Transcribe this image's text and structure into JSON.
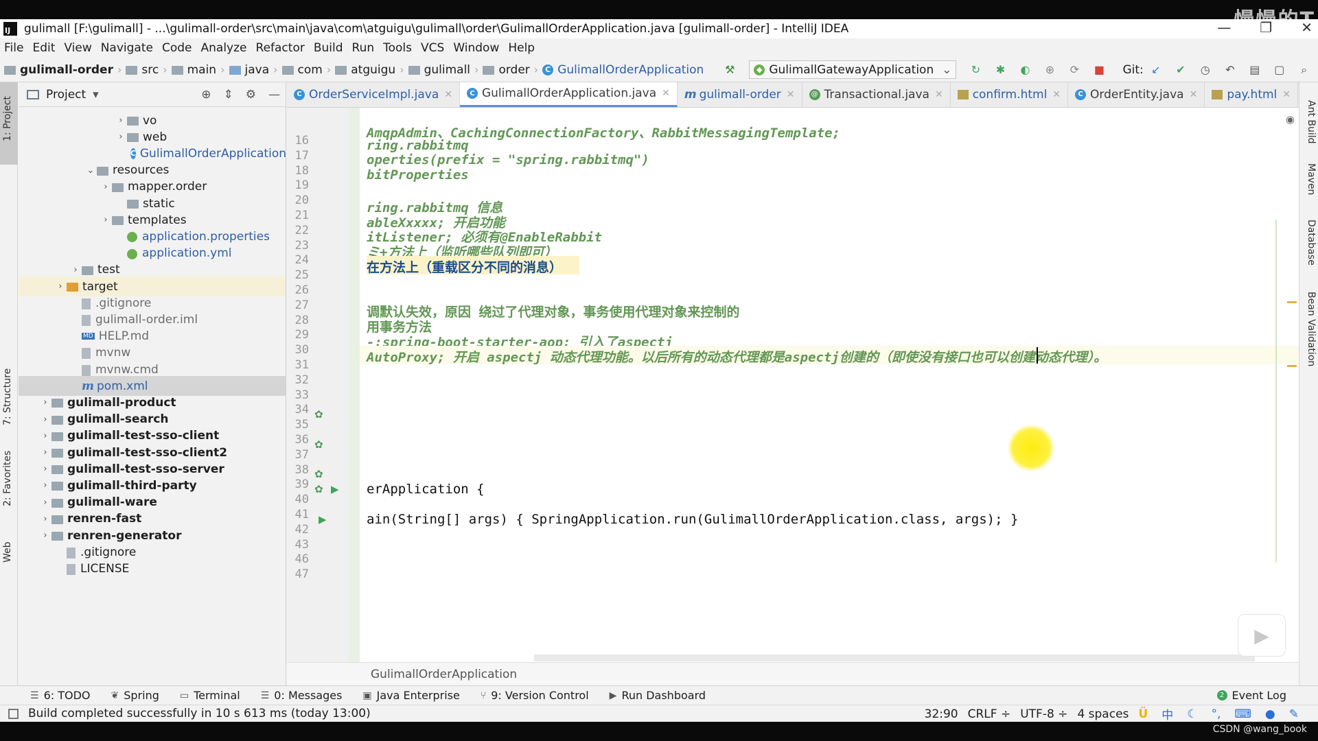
{
  "window": {
    "title": "gulimall [F:\\gulimall] - ...\\gulimall-order\\src\\main\\java\\com\\atguigu\\gulimall\\order\\GulimallOrderApplication.java [gulimall-order] - IntelliJ IDEA",
    "logo": "IJ",
    "minimize": "—",
    "maximize": "❐",
    "close": "✕"
  },
  "overlay": {
    "watermark_top": "慢慢的T",
    "watermark_bottom": "CSDN @wang_book"
  },
  "menu": [
    "File",
    "Edit",
    "View",
    "Navigate",
    "Code",
    "Analyze",
    "Refactor",
    "Build",
    "Run",
    "Tools",
    "VCS",
    "Window",
    "Help"
  ],
  "navbar": {
    "project": "gulimall-order",
    "crumbs": [
      "src",
      "main",
      "java",
      "com",
      "atguigu",
      "gulimall",
      "order"
    ],
    "class": "GulimallOrderApplication",
    "run_config": "GulimallGatewayApplication",
    "git_label": "Git:"
  },
  "sidebar_left": {
    "project": "1: Project",
    "structure": "7: Structure",
    "favorites": "2: Favorites",
    "web": "Web"
  },
  "sidebar_right": {
    "ant": "Ant Build",
    "maven": "Maven",
    "database": "Database",
    "bean": "Bean Validation"
  },
  "project_panel": {
    "title": "Project",
    "items": [
      {
        "label": "vo",
        "depth": 6,
        "arrow": "›",
        "icon": "folder"
      },
      {
        "label": "web",
        "depth": 6,
        "arrow": "›",
        "icon": "folder"
      },
      {
        "label": "GulimallOrderApplication",
        "depth": 7,
        "arrow": "",
        "icon": "class"
      },
      {
        "label": "resources",
        "depth": 4,
        "arrow": "⌄",
        "icon": "folder"
      },
      {
        "label": "mapper.order",
        "depth": 5,
        "arrow": "›",
        "icon": "folder"
      },
      {
        "label": "static",
        "depth": 6,
        "arrow": "",
        "icon": "folder"
      },
      {
        "label": "templates",
        "depth": 5,
        "arrow": "›",
        "icon": "folder"
      },
      {
        "label": "application.properties",
        "depth": 6,
        "arrow": "",
        "icon": "green"
      },
      {
        "label": "application.yml",
        "depth": 6,
        "arrow": "",
        "icon": "green"
      },
      {
        "label": "test",
        "depth": 3,
        "arrow": "›",
        "icon": "folder"
      },
      {
        "label": "target",
        "depth": 2,
        "arrow": "›",
        "icon": "folder-orange"
      },
      {
        "label": ".gitignore",
        "depth": 3,
        "arrow": "",
        "icon": "file"
      },
      {
        "label": "gulimall-order.iml",
        "depth": 3,
        "arrow": "",
        "icon": "file"
      },
      {
        "label": "HELP.md",
        "depth": 3,
        "arrow": "",
        "icon": "md"
      },
      {
        "label": "mvnw",
        "depth": 3,
        "arrow": "",
        "icon": "file"
      },
      {
        "label": "mvnw.cmd",
        "depth": 3,
        "arrow": "",
        "icon": "file"
      },
      {
        "label": "pom.xml",
        "depth": 3,
        "arrow": "",
        "icon": "maven"
      },
      {
        "label": "gulimall-product",
        "depth": 1,
        "arrow": "›",
        "icon": "folder"
      },
      {
        "label": "gulimall-search",
        "depth": 1,
        "arrow": "›",
        "icon": "folder"
      },
      {
        "label": "gulimall-test-sso-client",
        "depth": 1,
        "arrow": "›",
        "icon": "folder"
      },
      {
        "label": "gulimall-test-sso-client2",
        "depth": 1,
        "arrow": "›",
        "icon": "folder"
      },
      {
        "label": "gulimall-test-sso-server",
        "depth": 1,
        "arrow": "›",
        "icon": "folder"
      },
      {
        "label": "gulimall-third-party",
        "depth": 1,
        "arrow": "›",
        "icon": "folder"
      },
      {
        "label": "gulimall-ware",
        "depth": 1,
        "arrow": "›",
        "icon": "folder"
      },
      {
        "label": "renren-fast",
        "depth": 1,
        "arrow": "›",
        "icon": "folder"
      },
      {
        "label": "renren-generator",
        "depth": 1,
        "arrow": "›",
        "icon": "folder"
      },
      {
        "label": ".gitignore",
        "depth": 2,
        "arrow": "",
        "icon": "file"
      },
      {
        "label": "LICENSE",
        "depth": 2,
        "arrow": "",
        "icon": "file"
      }
    ]
  },
  "tabs": [
    {
      "label": "OrderServiceImpl.java",
      "icon": "C"
    },
    {
      "label": "GulimallOrderApplication.java",
      "icon": "C"
    },
    {
      "label": "gulimall-order",
      "icon": "m"
    },
    {
      "label": "Transactional.java",
      "icon": "@"
    },
    {
      "label": "confirm.html",
      "icon": "H"
    },
    {
      "label": "OrderEntity.java",
      "icon": "C"
    },
    {
      "label": "pay.html",
      "icon": "H"
    }
  ],
  "editor": {
    "lines": [
      {
        "n": "16",
        "text": ""
      },
      {
        "n": "17",
        "text": "AmqpAdmin、CachingConnectionFactory、RabbitMessagingTemplate;"
      },
      {
        "n": "18",
        "text": "ring.rabbitmq"
      },
      {
        "n": "19",
        "text": "operties(prefix = \"spring.rabbitmq\")"
      },
      {
        "n": "20",
        "text": "bitProperties"
      },
      {
        "n": "21",
        "text": ""
      },
      {
        "n": "22",
        "text": "ring.rabbitmq 信息"
      },
      {
        "n": "23",
        "text": "ableXxxxx; 开启功能"
      },
      {
        "n": "24",
        "text": "itListener; 必须有@EnableRabbit"
      },
      {
        "n": "25",
        "text": "ミ+方法上（监听哪些队列即可）"
      },
      {
        "n": "26",
        "text": "在方法上（重载区分不同的消息）"
      },
      {
        "n": "27",
        "text": ""
      },
      {
        "n": "28",
        "text": ""
      },
      {
        "n": "29",
        "text": "调默认失效，原因 绕过了代理对象，事务使用代理对象来控制的"
      },
      {
        "n": "30",
        "text": "用事务方法"
      },
      {
        "n": "31",
        "text": "-;spring-boot-starter-aop; 引入了aspectj"
      },
      {
        "n": "32",
        "text": "AutoProxy; 开启 aspectj 动态代理功能。以后所有的动态代理都是aspectj创建的（即使没有接口也可以创建动态代理）。"
      },
      {
        "n": "33",
        "text": ""
      },
      {
        "n": "34",
        "text": ""
      },
      {
        "n": "35",
        "text": ""
      },
      {
        "n": "36",
        "text": ""
      },
      {
        "n": "37",
        "text": ""
      },
      {
        "n": "38",
        "text": ""
      },
      {
        "n": "39",
        "text": ""
      },
      {
        "n": "40",
        "text": ""
      },
      {
        "n": "41",
        "text": "erApplication {"
      },
      {
        "n": "42",
        "text": ""
      },
      {
        "n": "43",
        "text": "ain(String[] args) { SpringApplication.run(GulimallOrderApplication.class, args); }"
      },
      {
        "n": "46",
        "text": ""
      },
      {
        "n": "47",
        "text": ""
      }
    ],
    "breadcrumb": "GulimallOrderApplication"
  },
  "bottom_tools": [
    {
      "label": "6: TODO",
      "icon": "☰"
    },
    {
      "label": "Spring",
      "icon": "❦"
    },
    {
      "label": "Terminal",
      "icon": "▭"
    },
    {
      "label": "0: Messages",
      "icon": "☰"
    },
    {
      "label": "Java Enterprise",
      "icon": "▣"
    },
    {
      "label": "9: Version Control",
      "icon": "⑂"
    },
    {
      "label": "Run Dashboard",
      "icon": "▶"
    }
  ],
  "event_log": "Event Log",
  "status": {
    "message": "Build completed successfully in 10 s 613 ms (today 13:00)",
    "position": "32:90",
    "line_sep": "CRLF ÷",
    "encoding": "UTF-8 ÷",
    "indent": "4 spaces",
    "ime_lang": "中"
  },
  "colors": {
    "comment": "#629755",
    "keyword": "#000080",
    "accent": "#3a92d6",
    "cursor_highlight": "#ffeb00"
  }
}
